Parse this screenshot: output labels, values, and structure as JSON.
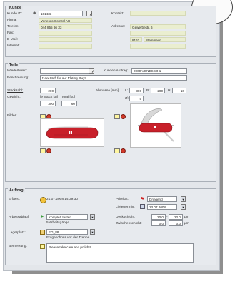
{
  "kunde": {
    "title": "Kunde",
    "kunde_id_label": "Kunde ID:",
    "kunde_id": "101433",
    "firma_label": "Firma:",
    "firma": "Vonesco Control AG",
    "telefon_label": "Telefon:",
    "telefon": "044 855 66 33",
    "fax_label": "Fax:",
    "email_label": "E-Mail:",
    "internet_label": "Internet:",
    "kontakt_label": "Kontakt:",
    "adresse_label": "Adresse:",
    "adresse": "Gewerbestr. 6",
    "plz": "8162",
    "ort": "Steinmaur"
  },
  "teile": {
    "title": "Teile",
    "wiederholen_label": "Wiederholen:",
    "kunden_auftrag_label": "Kunden Auftrag:",
    "kunden_auftrag": "2000 VONESCO 1",
    "beschreibung_label": "Beschreibung:",
    "beschreibung": "New Stuff for our Plating Guys",
    "stueckzahl_label": "Stückzahl:",
    "stueckzahl": "200",
    "abmasse_label": "Abmasse [mm]:",
    "l_label": "L:",
    "l": "300",
    "b_label": "B:",
    "b": "200",
    "h_label": "H:",
    "h": "10",
    "gewicht_label": "Gewicht:",
    "stueck_label": "[e Stück kg]",
    "total_label": "Total [kg]",
    "stueck_kg": "300",
    "total_kg": "60",
    "durchmesser_label": "Ø:",
    "durchmesser": "5",
    "bilder_label": "Bilder:"
  },
  "auftrag": {
    "title": "Auftrag",
    "erfasst_label": "Erfasst:",
    "erfasst": "21.07.2008 14:39:30",
    "prioritaet_label": "Priorität:",
    "prioritaet": "Dringend",
    "liefertermin_label": "Liefertermin:",
    "liefertermin": "23.07.2008",
    "arbeitsablauf_label": "Arbeitsablauf:",
    "arbeitsablauf": "Komplett testen",
    "arbeitsgaenge": "5 Arbeitsgänge",
    "deckschicht_label": "Deckschicht:",
    "deck_1": "20.0",
    "deck_2": "22.0",
    "zwischenschicht_label": "Zwischenschicht:",
    "zw_1": "0.0",
    "zw_2": "0.0",
    "unit": "µm",
    "lagerplatz_label": "Lagerplatz:",
    "lagerplatz": "EG_88",
    "lagerplatz_desc": "Erdgeschoss vor der Treppe",
    "bemerkung_label": "Bemerkung:",
    "bemerkung": "Please take care and polish!!!"
  },
  "colors": {
    "field_bg": "#eaeed0",
    "section_bg": "#e7eaee",
    "knife_red": "#c8202a"
  }
}
